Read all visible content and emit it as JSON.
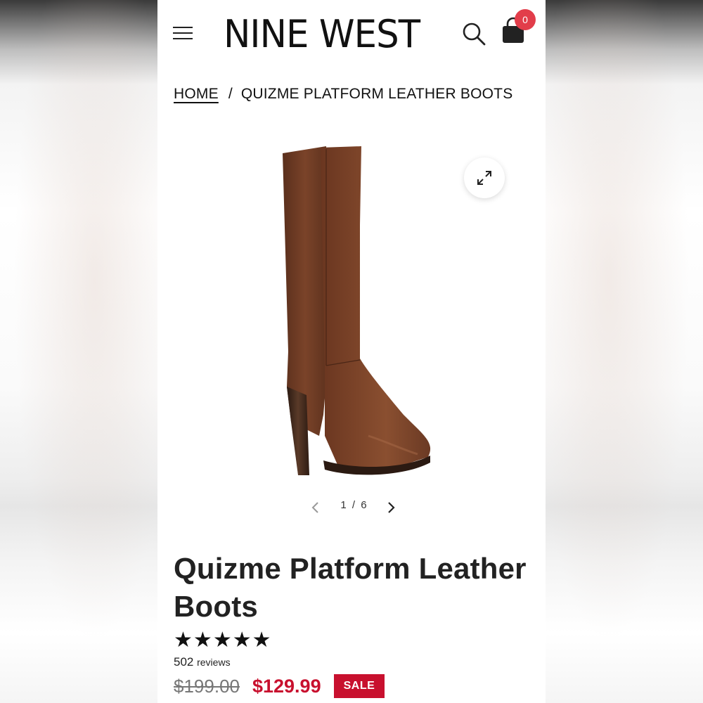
{
  "header": {
    "logo": "NINE WEST",
    "cart_count": "0"
  },
  "breadcrumb": {
    "home": "HOME",
    "separator": "/",
    "current": "QUIZME PLATFORM LEATHER BOOTS"
  },
  "gallery": {
    "current": "1",
    "separator": "/",
    "total": "6"
  },
  "product": {
    "title": "Quizme Platform Leather Boots",
    "rating": 5,
    "stars": [
      "★",
      "★",
      "★",
      "★",
      "★"
    ],
    "review_count": "502",
    "review_label": "reviews",
    "original_price": "$199.00",
    "sale_price": "$129.99",
    "sale_badge": "SALE"
  },
  "colors": {
    "accent_red": "#c8102e",
    "badge_red": "#e23d4a",
    "boot_brown": "#6b3a24"
  },
  "icons": {
    "menu": "menu-icon",
    "search": "search-icon",
    "cart": "shopping-bag-icon",
    "expand": "expand-icon",
    "prev": "chevron-left-icon",
    "next": "chevron-right-icon"
  }
}
